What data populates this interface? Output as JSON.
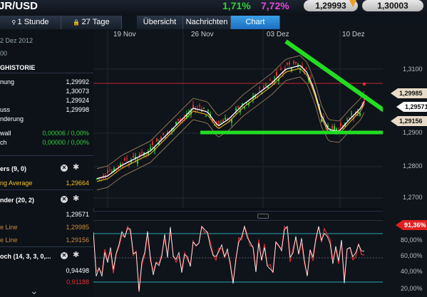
{
  "header": {
    "symbol": "JR/USD",
    "change_pct": "1,71%",
    "change_pct2": "7,72%",
    "bid": "1,29993",
    "ask": "1,30003"
  },
  "tabs": {
    "interval": "1 Stunde",
    "range": "27 Tage",
    "overview": "Übersicht",
    "news": "Nachrichten",
    "chart": "Chart"
  },
  "sidebar": {
    "date": "2 Dez 2012",
    "time": "00",
    "history_label": "GHISTORIE",
    "rows": [
      {
        "label": "nung",
        "value": "1,29992"
      },
      {
        "label": "",
        "value": "1,30073"
      },
      {
        "label": "",
        "value": "1,29924"
      },
      {
        "label": "uss",
        "value": "1,29998"
      },
      {
        "label": "nderung",
        "value": ""
      },
      {
        "label": "wall",
        "value": "0,00006 / 0,00%"
      },
      {
        "label": "ch",
        "value": "0,00000 / 0,00%"
      }
    ],
    "indicators": [
      {
        "label": "ers (9, 0)",
        "value": ""
      },
      {
        "label": "ng Average",
        "value": "1,29664"
      },
      {
        "label": "nder (20, 2)",
        "value": ""
      },
      {
        "label": "",
        "value": "1,29571"
      },
      {
        "label": "e Line",
        "value": "1,29985"
      },
      {
        "label": "e Line",
        "value": "1,29156"
      },
      {
        "label": "och (14, 3, 3, 0,...",
        "value": ""
      },
      {
        "label": "",
        "value": "0,94498"
      },
      {
        "label": "",
        "value": "0,91188"
      }
    ]
  },
  "chart": {
    "dates": [
      "19 Nov",
      "26 Nov",
      "03 Dez",
      "10 Dez"
    ],
    "y_ticks": [
      "1,3100",
      "1,2900",
      "1,2800",
      "1,2700"
    ],
    "price_tags": [
      "1,29985",
      "1,29571",
      "1,29156"
    ],
    "ind_badge": "91,36%",
    "ind_ticks": [
      "80,00%",
      "60,00%",
      "40,00%",
      "20,00%"
    ],
    "colors": {
      "accent": "#1e8ee8",
      "green_line": "#22dd22",
      "red": "#e03030"
    }
  }
}
